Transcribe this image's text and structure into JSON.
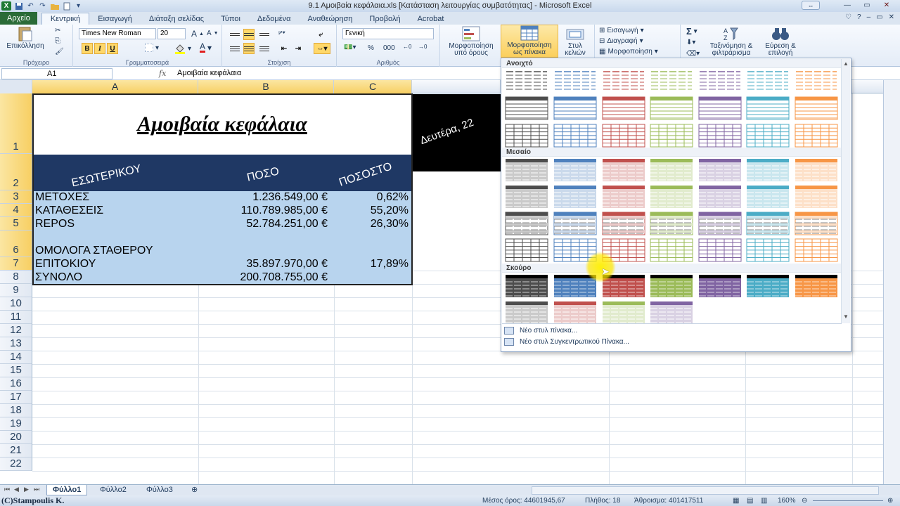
{
  "window": {
    "title": "9.1 Αμοιβαία κεφάλαια.xls  [Κατάσταση λειτουργίας συμβατότητας]  -  Microsoft Excel"
  },
  "tabs": [
    "Αρχείο",
    "Κεντρική",
    "Εισαγωγή",
    "Διάταξη σελίδας",
    "Τύποι",
    "Δεδομένα",
    "Αναθεώρηση",
    "Προβολή",
    "Acrobat"
  ],
  "ribbon": {
    "clipboard": {
      "label": "Πρόχειρο",
      "paste": "Επικόλληση"
    },
    "font": {
      "label": "Γραμματοσειρά",
      "name": "Times New Roman",
      "size": "20",
      "bold": "B",
      "italic": "I",
      "underline": "U"
    },
    "alignment": {
      "label": "Στοίχιση"
    },
    "number": {
      "label": "Αριθμός",
      "format": "Γενική",
      "percent": "%",
      "thousands": "000"
    },
    "styles": {
      "conditional": [
        "Μορφοποίηση",
        "υπό όρους"
      ],
      "as_table": [
        "Μορφοποίηση",
        "ως πίνακα"
      ],
      "cell_styles": [
        "Στυλ",
        "κελιών"
      ]
    },
    "cells": {
      "insert": "Εισαγωγή",
      "delete": "Διαγραφή",
      "format": "Μορφοποίηση"
    },
    "editing": {
      "sum": "Σ",
      "sort": [
        "Ταξινόμηση &",
        "φιλτράρισμα"
      ],
      "find": [
        "Εύρεση &",
        "επιλογή"
      ]
    }
  },
  "formula_bar": {
    "name_box": "A1",
    "fx": "fx",
    "content": "Αμοιβαία κεφάλαια"
  },
  "columns": [
    "A",
    "B",
    "C"
  ],
  "rows": [
    "1",
    "2",
    "3",
    "4",
    "5",
    "6",
    "7",
    "8",
    "9",
    "10",
    "11",
    "12",
    "13",
    "14",
    "15",
    "16",
    "17",
    "18",
    "19",
    "20",
    "21",
    "22"
  ],
  "sheet": {
    "title": "Αμοιβαία κεφάλαια",
    "headers": [
      "ΕΣΩΤΕΡΙΚΟΥ",
      "ΠΟΣΟ",
      "ΠΟΣΟΣΤΟ"
    ],
    "date_partial": "Δευτέρα, 22",
    "data": [
      {
        "name": "ΜΕΤΟΧΕΣ",
        "amount": "1.236.549,00 €",
        "pct": "0,62%"
      },
      {
        "name": "ΚΑΤΑΘΕΣΕΙΣ",
        "amount": "110.789.985,00 €",
        "pct": "55,20%"
      },
      {
        "name": "REPOS",
        "amount": "52.784.251,00 €",
        "pct": "26,30%"
      },
      {
        "name_l1": "ΟΜΟΛΟΓΑ ΣΤΑΘΕΡΟΥ",
        "name_l2": "ΕΠΙΤΟΚΙΟΥ",
        "amount": "35.897.970,00 €",
        "pct": "17,89%"
      },
      {
        "name": "ΣΥΝΟΛΟ",
        "amount": "200.708.755,00 €"
      }
    ]
  },
  "gallery": {
    "sections": [
      "Ανοιχτό",
      "Μεσαίο",
      "Σκούρο"
    ],
    "new_table_style": "Νέο στυλ πίνακα...",
    "new_pivot_style": "Νέο στυλ Συγκεντρωτικού Πίνακα...",
    "palette": [
      "#4d4d4d",
      "#4f81bd",
      "#c0504d",
      "#9bbb59",
      "#8064a2",
      "#4bacc6",
      "#f79646"
    ]
  },
  "sheets": [
    "Φύλλο1",
    "Φύλλο2",
    "Φύλλο3"
  ],
  "status": {
    "average": "Μέσος όρος: 44601945,67",
    "count": "Πλήθος: 18",
    "sum": "Άθροισμα: 401417511",
    "zoom": "160%"
  },
  "watermark": "(C)Stampoulis K."
}
